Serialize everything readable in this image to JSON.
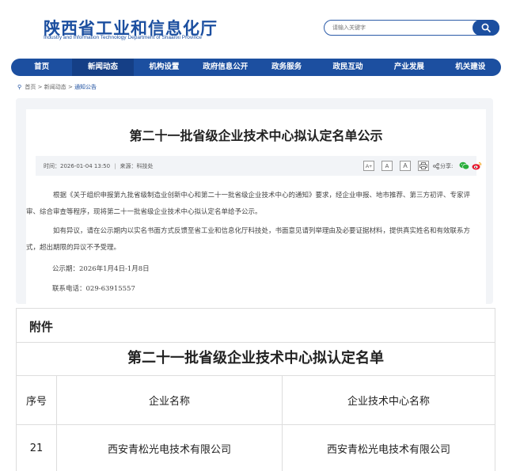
{
  "header": {
    "title": "陕西省工业和信息化厅",
    "subtitle": "Industry and Information Technology Department of Shaanxi Province",
    "search_placeholder": "请输入关键字",
    "brand_color": "#1c4fa0"
  },
  "nav": {
    "items": [
      {
        "label": "首页"
      },
      {
        "label": "新闻动态"
      },
      {
        "label": "机构设置"
      },
      {
        "label": "政府信息公开"
      },
      {
        "label": "政务服务"
      },
      {
        "label": "政民互动"
      },
      {
        "label": "产业发展"
      },
      {
        "label": "机关建设"
      }
    ],
    "active_index": 1
  },
  "breadcrumb": {
    "items": [
      "首页",
      "新闻动态",
      "通知公告"
    ],
    "separator": ">"
  },
  "article": {
    "title": "第二十一批省级企业技术中心拟认定名单公示",
    "meta": {
      "time_label": "时间：",
      "time": "2026-01-04 13:50",
      "divider": "|",
      "source_label": "来源：",
      "source": "科技处"
    },
    "font_buttons": [
      "A+",
      "A",
      "A"
    ],
    "share_label": "分享:",
    "paragraphs": [
      "根据《关于组织申报第九批省级制造业创新中心和第二十一批省级企业技术中心的通知》要求，经企业申报、地市推荐、第三方初评、专家评审、综合审查等程序，现将第二十一批省级企业技术中心拟认定名单给予公示。",
      "如有异议，请在公示期内以实名书面方式反馈至省工业和信息化厅科技处，书面意见请列举理由及必要证据材料，提供真实姓名和有效联系方式，超出期限的异议不予受理。"
    ],
    "period": "公示期：2026年1月4日-1月8日",
    "phone": "联系电话：029-63915557"
  },
  "attachment": {
    "heading": "附件",
    "table_title": "第二十一批省级企业技术中心拟认定名单",
    "columns": [
      "序号",
      "企业名称",
      "企业技术中心名称"
    ],
    "rows": [
      [
        "21",
        "西安青松光电技术有限公司",
        "西安青松光电技术有限公司"
      ]
    ]
  }
}
